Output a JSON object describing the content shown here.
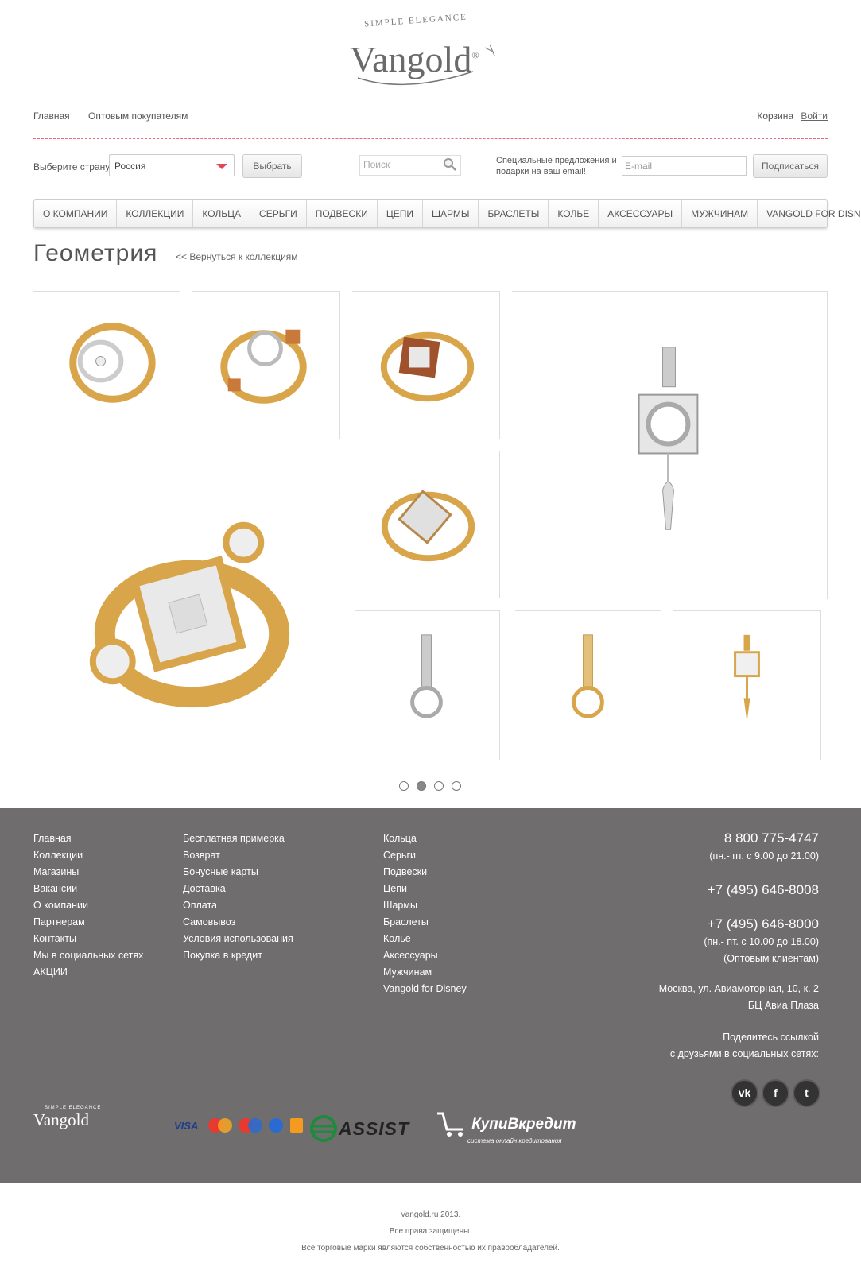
{
  "brand": {
    "tagline": "SIMPLE ELEGANCE",
    "name": "Vangold"
  },
  "topnav": {
    "home": "Главная",
    "wholesale": "Оптовым покупателям",
    "cart": "Корзина",
    "login": "Войти"
  },
  "filters": {
    "country_label": "Выберите страну",
    "country_value": "Россия",
    "choose_button": "Выбрать",
    "search_placeholder": "Поиск",
    "promo_text": "Специальные предложения и подарки на ваш email!",
    "email_placeholder": "E-mail",
    "subscribe_button": "Подписаться"
  },
  "menu": [
    "О КОМПАНИИ",
    "КОЛЛЕКЦИИ",
    "КОЛЬЦА",
    "СЕРЬГИ",
    "ПОДВЕСКИ",
    "ЦЕПИ",
    "ШАРМЫ",
    "БРАСЛЕТЫ",
    "КОЛЬЕ",
    "АКСЕССУАРЫ",
    "МУЖЧИНАМ",
    "VANGOLD FOR DISNEY"
  ],
  "page": {
    "title": "Геометрия",
    "back_link": "<< Вернуться к коллекциям"
  },
  "pagination": {
    "pages": 4,
    "current": 2
  },
  "footer": {
    "col1": [
      "Главная",
      "Коллекции",
      "Магазины",
      "Вакансии",
      "О компании",
      "Партнерам",
      "Контакты",
      "Мы в социальных сетях",
      "АКЦИИ"
    ],
    "col2": [
      "Бесплатная примерка",
      "Возврат",
      "Бонусные карты",
      "Доставка",
      "Оплата",
      "Самовывоз",
      "Условия использования",
      "Покупка в кредит"
    ],
    "col3": [
      "Кольца",
      "Серьги",
      "Подвески",
      "Цепи",
      "Шармы",
      "Браслеты",
      "Колье",
      "Аксессуары",
      "Мужчинам",
      "Vangold for Disney"
    ],
    "phone1": "8 800 775-4747",
    "hours1": "(пн.- пт. с 9.00 до 21.00)",
    "phone2": "+7 (495) 646-8008",
    "phone3": "+7 (495) 646-8000",
    "hours3": "(пн.- пт. с 10.00 до 18.00)",
    "wholesale_note": "(Оптовым клиентам)",
    "address1": "Москва, ул. Авиамоторная, 10, к. 2",
    "address2": "БЦ Авиа Плаза",
    "share1": "Поделитесь ссылкой",
    "share2": "с друзьями в социальных сетях:",
    "social": [
      "vk",
      "f",
      "t"
    ],
    "logo_tagline": "SIMPLE ELEGANCE",
    "logo_name": "Vangold",
    "visa": "VISA",
    "assist": "ASSIST",
    "kupi": "КупиВкредит",
    "kupi_sub": "система онлайн кредитования"
  },
  "copyright": [
    "Vangold.ru 2013.",
    "Все права защищены.",
    "Все торговые марки являются собственностью их правообладателей."
  ],
  "colors": {
    "accent": "#e0475b",
    "footer_bg": "#706d6e",
    "gold": "#d9a54a",
    "silver": "#c8c8c8"
  }
}
